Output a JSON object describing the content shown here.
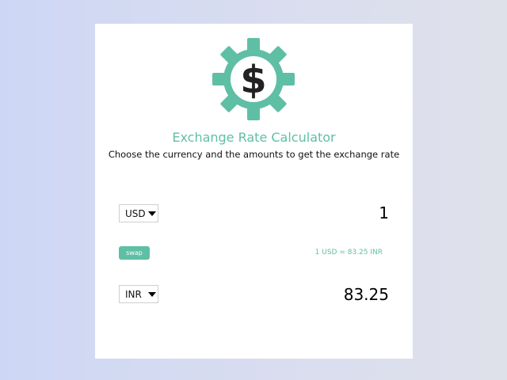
{
  "header": {
    "title": "Exchange Rate Calculator",
    "subtitle": "Choose the currency and the amounts to get the exchange rate",
    "logo_icon": "gear-dollar-icon"
  },
  "colors": {
    "accent": "#5fbfa5",
    "background_left": "#cdd7f5",
    "background_right": "#dfe1ea",
    "card": "#ffffff",
    "text": "#111111"
  },
  "currency_one": {
    "selected": "USD",
    "amount": "1"
  },
  "swap": {
    "label": "swap"
  },
  "rate": {
    "text": "1 USD = 83.25 INR"
  },
  "currency_two": {
    "selected": "INR",
    "amount": "83.25"
  }
}
